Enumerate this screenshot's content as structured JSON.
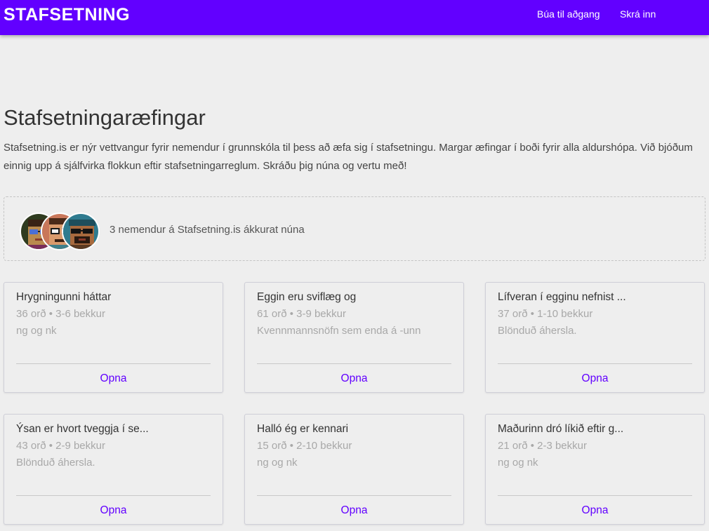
{
  "header": {
    "brand": "STAFSETNING",
    "nav": [
      {
        "label": "Búa til aðgang"
      },
      {
        "label": "Skrá inn"
      }
    ]
  },
  "main": {
    "title": "Stafsetningaræfingar",
    "intro": "Stafsetning.is er nýr vettvangur fyrir nemendur í grunnskóla til þess að æfa sig í stafsetningu. Margar æfingar í boði fyrir alla aldurshópa. Við bjóðum einnig upp á sjálfvirka flokkun eftir stafsetningarreglum. Skráðu þig núna og vertu með!",
    "online": {
      "text": "3 nemendur á Stafsetning.is ákkurat núna",
      "avatars": [
        "pixel-avatar-blue-glasses",
        "pixel-avatar-white-glasses",
        "pixel-avatar-sunglasses"
      ]
    },
    "open_label": "Opna",
    "exercises": [
      {
        "title": "Hrygningunni háttar",
        "meta": "36 orð • 3-6 bekkur",
        "desc": "ng og nk"
      },
      {
        "title": "Eggin eru sviflæg og",
        "meta": "61 orð • 3-9 bekkur",
        "desc": "Kvennmannsnöfn sem enda á -unn"
      },
      {
        "title": "Lífveran í egginu nefnist ...",
        "meta": "37 orð • 1-10 bekkur",
        "desc": "Blönduð áhersla."
      },
      {
        "title": "Ýsan er hvort tveggja í se...",
        "meta": "43 orð • 2-9 bekkur",
        "desc": "Blönduð áhersla."
      },
      {
        "title": "Halló ég er kennari",
        "meta": "15 orð • 2-10 bekkur",
        "desc": "ng og nk"
      },
      {
        "title": "Maðurinn dró líkið eftir g...",
        "meta": "21 orð • 2-3 bekkur",
        "desc": "ng og nk"
      }
    ]
  },
  "colors": {
    "accent": "#6200ff",
    "background": "#eeeeee"
  }
}
